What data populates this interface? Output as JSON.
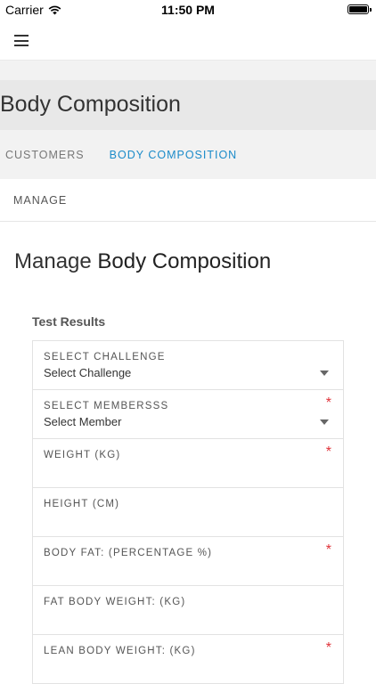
{
  "status": {
    "carrier": "Carrier",
    "time": "11:50 PM"
  },
  "header": {
    "title": "Body Composition"
  },
  "breadcrumb": {
    "items": [
      "CUSTOMERS",
      "BODY COMPOSITION"
    ],
    "separator": ""
  },
  "manage_bar": {
    "label": "MANAGE",
    "arrow": ""
  },
  "main": {
    "heading_prefix": "Manage",
    "heading_emph": "Body Composition",
    "subheading": "Test Results"
  },
  "form": {
    "fields": [
      {
        "label": "SELECT CHALLENGE",
        "value": "Select Challenge",
        "required": false,
        "type": "select"
      },
      {
        "label": "SELECT MEMBERSSS",
        "value": "Select Member",
        "required": true,
        "type": "select"
      },
      {
        "label": "WEIGHT (KG)",
        "value": "",
        "required": true,
        "type": "input"
      },
      {
        "label": "HEIGHT (CM)",
        "value": "",
        "required": false,
        "type": "input"
      },
      {
        "label": "BODY FAT: (PERCENTAGE %)",
        "value": "",
        "required": true,
        "type": "input"
      },
      {
        "label": "FAT BODY WEIGHT: (KG)",
        "value": "",
        "required": false,
        "type": "input"
      },
      {
        "label": "LEAN BODY WEIGHT: (KG)",
        "value": "",
        "required": true,
        "type": "input"
      }
    ],
    "required_mark": "*"
  },
  "colors": {
    "accent": "#1b8bc9",
    "required": "#e0333a",
    "title_band": "#e8e8e8"
  }
}
